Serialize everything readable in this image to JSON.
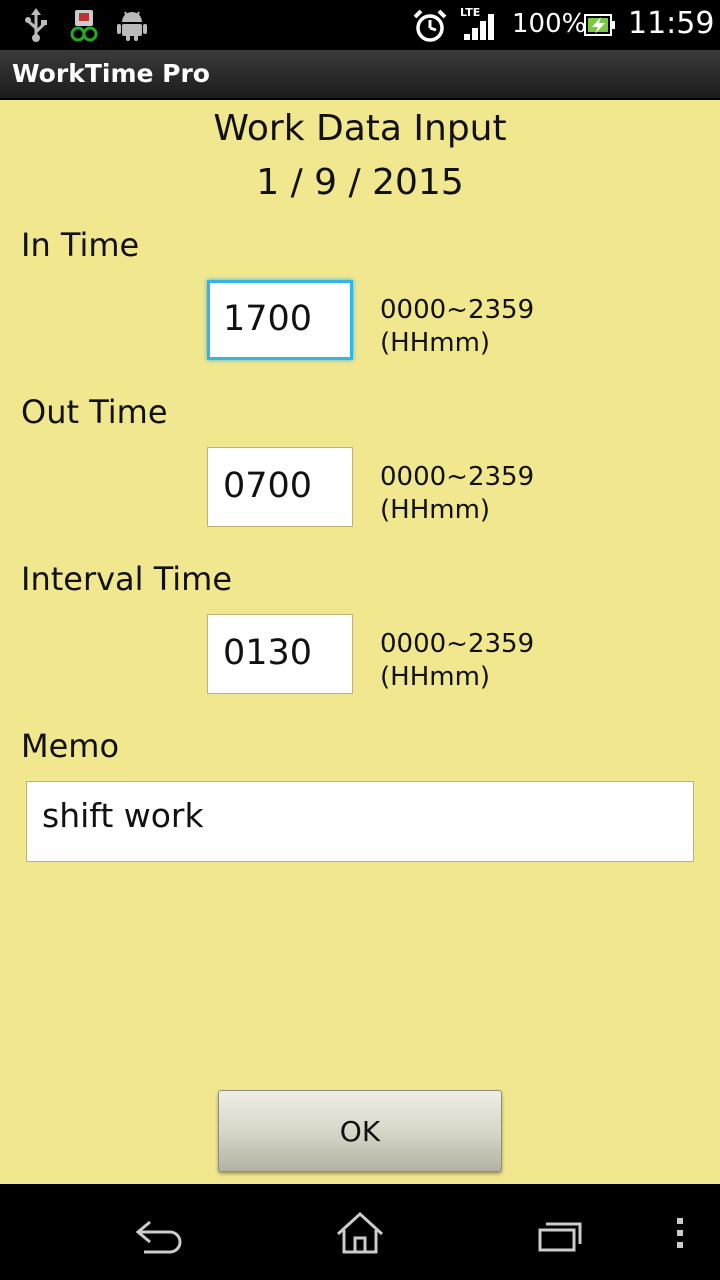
{
  "status_bar": {
    "icons": [
      "usb-icon",
      "app-notification-icon",
      "android-icon",
      "alarm-icon",
      "lte-signal-icon",
      "battery-charging-icon"
    ],
    "network_label": "LTE",
    "battery_percent": "100%",
    "time": "11:59"
  },
  "app": {
    "title": "WorkTime Pro"
  },
  "header": {
    "title": "Work Data Input",
    "date": "1 / 9 / 2015"
  },
  "fields": {
    "in_time": {
      "label": "In Time",
      "value": "1700",
      "hint_range": "0000~2359",
      "hint_format": "(HHmm)"
    },
    "out_time": {
      "label": "Out Time",
      "value": "0700",
      "hint_range": "0000~2359",
      "hint_format": "(HHmm)"
    },
    "interval_time": {
      "label": "Interval Time",
      "value": "0130",
      "hint_range": "0000~2359",
      "hint_format": "(HHmm)"
    },
    "memo": {
      "label": "Memo",
      "value": "shift work"
    }
  },
  "ok_button": {
    "label": "OK"
  },
  "nav_bar": {
    "buttons": [
      "back-icon",
      "home-icon",
      "recent-apps-icon",
      "overflow-menu-icon"
    ]
  },
  "colors": {
    "background": "#f1e78f",
    "focus": "#33b5e5",
    "bars": "#000000"
  }
}
